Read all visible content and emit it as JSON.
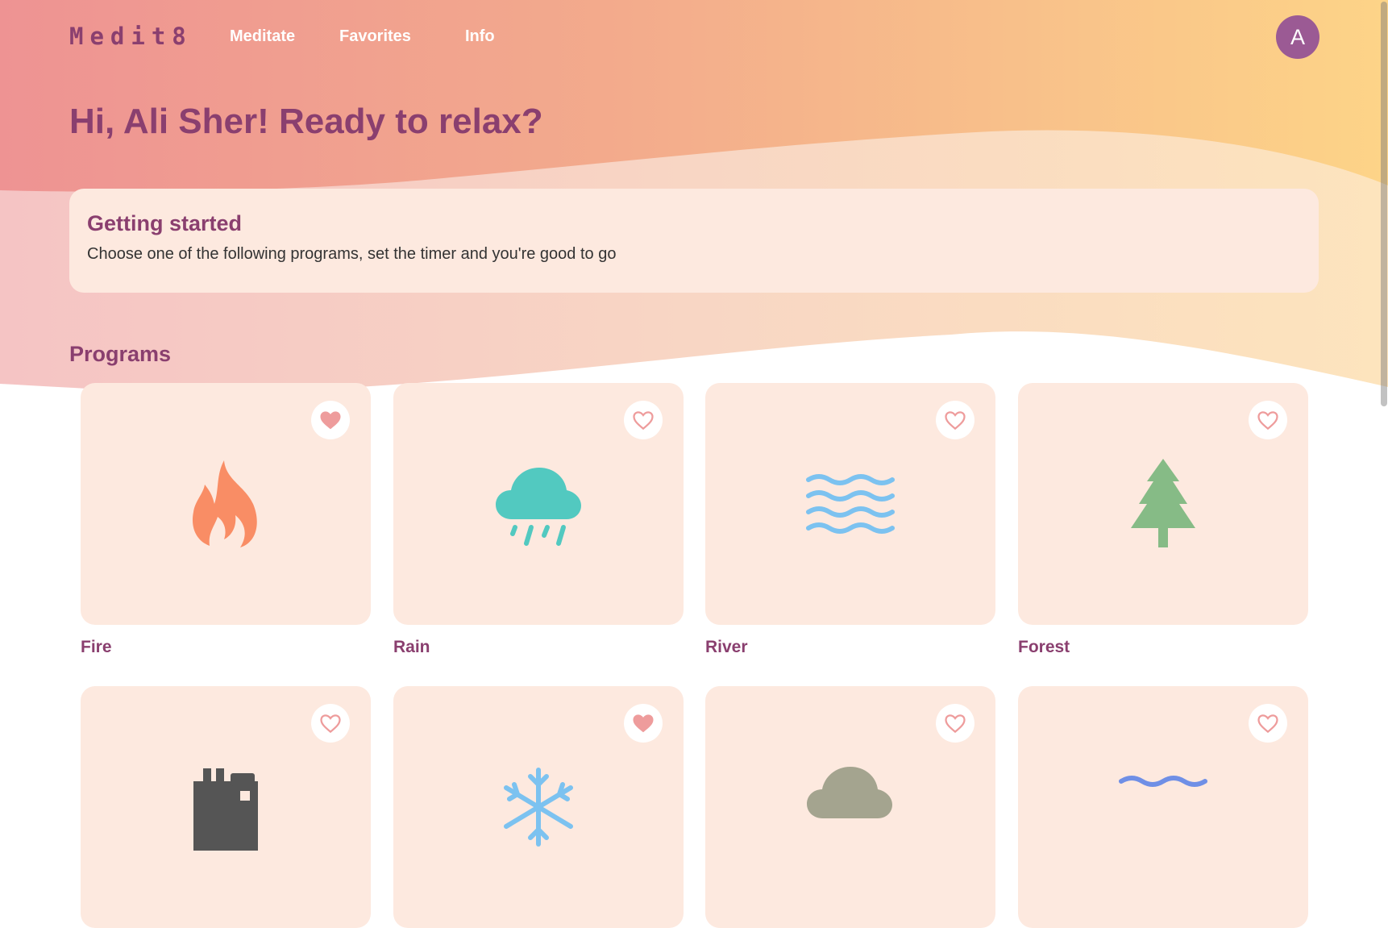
{
  "header": {
    "logo": "Medit8",
    "nav": [
      "Meditate",
      "Favorites",
      "Info"
    ],
    "avatar_initial": "A"
  },
  "greeting": "Hi, Ali Sher! Ready to relax?",
  "getting_started": {
    "title": "Getting started",
    "text": "Choose one of the following programs, set the timer and you're good to go"
  },
  "programs_title": "Programs",
  "programs": [
    {
      "label": "Fire",
      "icon": "fire-icon",
      "favorited": true,
      "color": "#f98d65"
    },
    {
      "label": "Rain",
      "icon": "rain-cloud-icon",
      "favorited": false,
      "color": "#52c9c0"
    },
    {
      "label": "River",
      "icon": "waves-icon",
      "favorited": false,
      "color": "#7cc2f0"
    },
    {
      "label": "Forest",
      "icon": "tree-icon",
      "favorited": false,
      "color": "#86bb86"
    },
    {
      "label": "",
      "icon": "factory-icon",
      "favorited": false,
      "color": "#555555"
    },
    {
      "label": "",
      "icon": "snowflake-icon",
      "favorited": true,
      "color": "#7cc2f0"
    },
    {
      "label": "",
      "icon": "cloud-icon",
      "favorited": false,
      "color": "#a4a48f"
    },
    {
      "label": "",
      "icon": "wave-icon",
      "favorited": false,
      "color": "#6f8fe6"
    }
  ],
  "colors": {
    "accent": "#8a3f6f",
    "card_bg": "#fde9df",
    "heart": "#ee9c9c",
    "avatar_bg": "#9b5a94"
  }
}
